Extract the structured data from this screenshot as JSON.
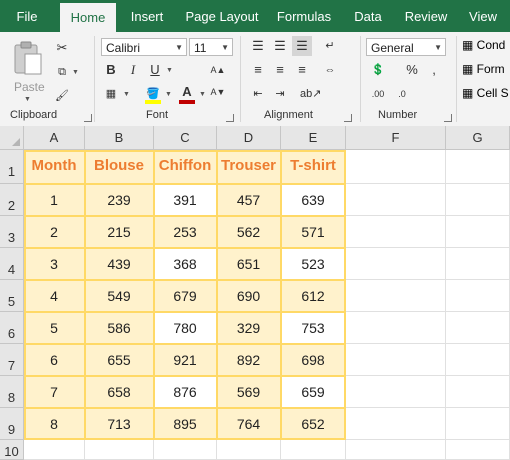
{
  "ribbon": {
    "tabs": [
      "File",
      "Home",
      "Insert",
      "Page Layout",
      "Formulas",
      "Data",
      "Review",
      "View"
    ],
    "active_tab": "Home",
    "groups": {
      "clipboard": "Clipboard",
      "font": "Font",
      "alignment": "Alignment",
      "number": "Number"
    },
    "paste_label": "Paste",
    "font_name": "Calibri",
    "font_size": "11",
    "number_format": "General",
    "styles": [
      "Conditional Formatting",
      "Format as Table",
      "Cell Styles"
    ],
    "styles_visible": [
      "Cond",
      "Form",
      "Cell S"
    ],
    "bold": "B",
    "italic": "I",
    "underline": "U",
    "font_color_hex": "#c00000",
    "fill_color_hex": "#ffff00"
  },
  "sheet": {
    "columns": [
      "A",
      "B",
      "C",
      "D",
      "E",
      "F",
      "G"
    ],
    "rows": [
      "1",
      "2",
      "3",
      "4",
      "5",
      "6",
      "7",
      "8",
      "9",
      "10"
    ],
    "header": [
      "Month",
      "Blouse",
      "Chiffon",
      "Trouser",
      "T-shirt"
    ],
    "data": [
      [
        "1",
        "239",
        "391",
        "457",
        "639"
      ],
      [
        "2",
        "215",
        "253",
        "562",
        "571"
      ],
      [
        "3",
        "439",
        "368",
        "651",
        "523"
      ],
      [
        "4",
        "549",
        "679",
        "690",
        "612"
      ],
      [
        "5",
        "586",
        "780",
        "329",
        "753"
      ],
      [
        "6",
        "655",
        "921",
        "892",
        "698"
      ],
      [
        "7",
        "658",
        "876",
        "569",
        "659"
      ],
      [
        "8",
        "713",
        "895",
        "764",
        "652"
      ]
    ],
    "colors": {
      "header_text": "#ed7d31",
      "fill": "#fff2cc",
      "border": "#ffd966"
    }
  }
}
